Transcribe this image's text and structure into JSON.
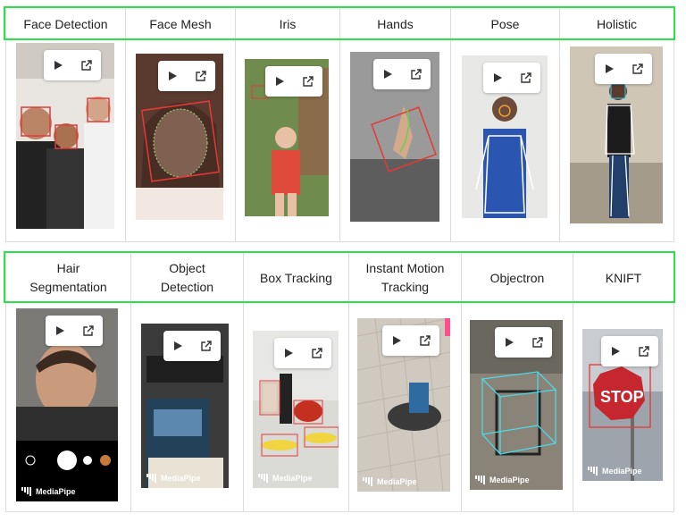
{
  "rows": [
    {
      "items": [
        {
          "id": "face-detection",
          "label": [
            "Face Detection"
          ],
          "scene": "face-detection"
        },
        {
          "id": "face-mesh",
          "label": [
            "Face Mesh"
          ],
          "scene": "face-mesh"
        },
        {
          "id": "iris",
          "label": [
            "Iris"
          ],
          "scene": "iris"
        },
        {
          "id": "hands",
          "label": [
            "Hands"
          ],
          "scene": "hands"
        },
        {
          "id": "pose",
          "label": [
            "Pose"
          ],
          "scene": "pose"
        },
        {
          "id": "holistic",
          "label": [
            "Holistic"
          ],
          "scene": "holistic"
        }
      ]
    },
    {
      "items": [
        {
          "id": "hair-segmentation",
          "label": [
            "Hair",
            "Segmentation"
          ],
          "scene": "hair"
        },
        {
          "id": "object-detection",
          "label": [
            "Object",
            "Detection"
          ],
          "scene": "object"
        },
        {
          "id": "box-tracking",
          "label": [
            "Box Tracking"
          ],
          "scene": "box"
        },
        {
          "id": "instant-motion-tracking",
          "label": [
            "Instant Motion",
            "Tracking"
          ],
          "scene": "motion"
        },
        {
          "id": "objectron",
          "label": [
            "Objectron"
          ],
          "scene": "objectron"
        },
        {
          "id": "knift",
          "label": [
            "KNIFT"
          ],
          "scene": "knift"
        }
      ]
    }
  ],
  "brand": "MediaPipe",
  "icons": {
    "play": "play-icon",
    "open": "external-link-icon"
  },
  "colors": {
    "highlight": "#2ee04a",
    "grid": "#dcdcdc",
    "overlay_red": "#e53935"
  }
}
